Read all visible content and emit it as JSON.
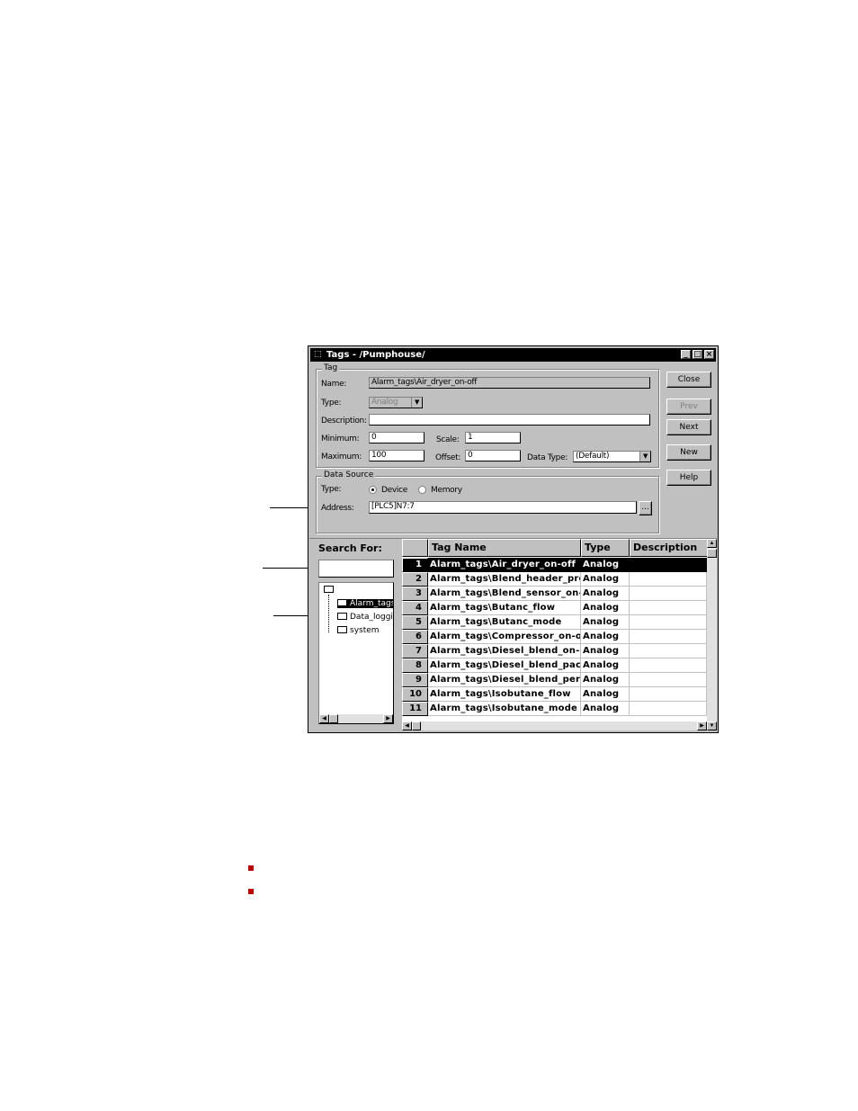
{
  "window": {
    "title": "Tags - /Pumphouse/",
    "min_glyph": "_",
    "max_glyph": "□",
    "close_glyph": "×"
  },
  "tag_group": {
    "label": "Tag",
    "name_label": "Name:",
    "name_value": "Alarm_tags\\Air_dryer_on-off",
    "type_label": "Type:",
    "type_value": "Analog",
    "description_label": "Description:",
    "description_value": "",
    "minimum_label": "Minimum:",
    "minimum_value": "0",
    "maximum_label": "Maximum:",
    "maximum_value": "100",
    "scale_label": "Scale:",
    "scale_value": "1",
    "offset_label": "Offset:",
    "offset_value": "0",
    "data_type_label": "Data Type:",
    "data_type_value": "(Default)"
  },
  "data_source": {
    "label": "Data Source",
    "type_label": "Type:",
    "device_label": "Device",
    "memory_label": "Memory",
    "selected": "Device",
    "address_label": "Address:",
    "address_value": "[PLC5]N7:7",
    "browse_label": "..."
  },
  "buttons": {
    "close": "Close",
    "prev": "Prev",
    "next": "Next",
    "new": "New",
    "help": "Help"
  },
  "search": {
    "label": "Search For:",
    "value": ""
  },
  "tree": {
    "items": [
      "Alarm_tags",
      "Data_logging",
      "system"
    ]
  },
  "grid": {
    "columns": [
      "Tag Name",
      "Type",
      "Description"
    ],
    "rows": [
      {
        "num": "1",
        "name": "Alarm_tags\\Air_dryer_on-off",
        "type": "Analog"
      },
      {
        "num": "2",
        "name": "Alarm_tags\\Blend_header_pressure",
        "type": "Analog"
      },
      {
        "num": "3",
        "name": "Alarm_tags\\Blend_sensor_on-off",
        "type": "Analog"
      },
      {
        "num": "4",
        "name": "Alarm_tags\\Butanc_flow",
        "type": "Analog"
      },
      {
        "num": "5",
        "name": "Alarm_tags\\Butanc_mode",
        "type": "Analog"
      },
      {
        "num": "6",
        "name": "Alarm_tags\\Compressor_on-off",
        "type": "Analog"
      },
      {
        "num": "7",
        "name": "Alarm_tags\\Diesel_blend_on-off",
        "type": "Analog"
      },
      {
        "num": "8",
        "name": "Alarm_tags\\Diesel_blend_pack",
        "type": "Analog"
      },
      {
        "num": "9",
        "name": "Alarm_tags\\Diesel_blend_percent",
        "type": "Analog"
      },
      {
        "num": "10",
        "name": "Alarm_tags\\Isobutane_flow",
        "type": "Analog"
      },
      {
        "num": "11",
        "name": "Alarm_tags\\Isobutane_mode",
        "type": "Analog"
      }
    ],
    "selected_row": 1
  }
}
